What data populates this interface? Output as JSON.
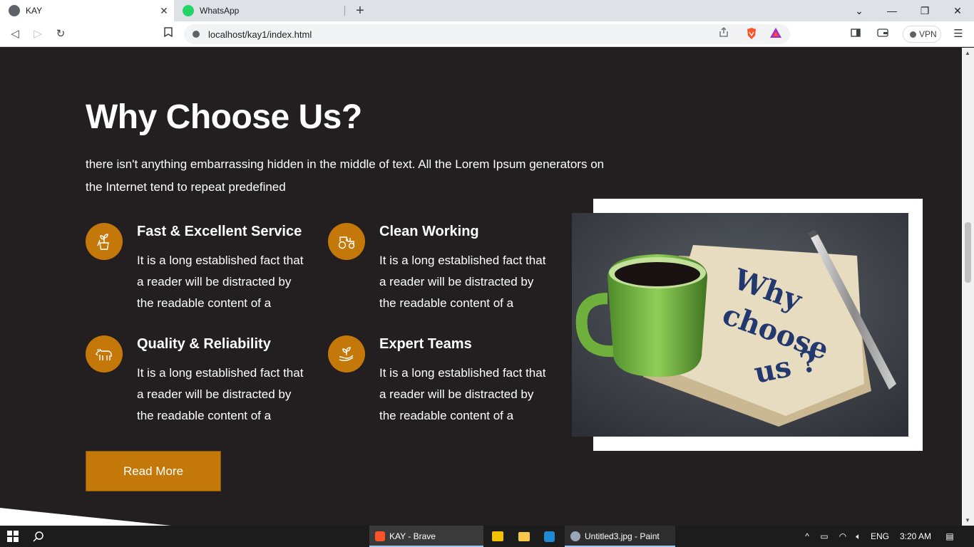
{
  "browser": {
    "tabs": [
      {
        "title": "KAY",
        "active": true
      },
      {
        "title": "WhatsApp",
        "active": false
      }
    ],
    "new_tab_icon": "+",
    "url": "localhost/kay1/index.html",
    "vpn_label": "VPN",
    "window_controls": {
      "minimize": "—",
      "restore": "❐",
      "close": "✕"
    }
  },
  "section": {
    "heading": "Why Choose Us?",
    "intro": "there isn't anything embarrassing hidden in the middle of text. All the Lorem Ipsum generators on the Internet tend to repeat predefined",
    "features": [
      {
        "title": "Fast & Excellent Service",
        "desc": "It is a long established fact that a reader will be distracted by the readable content of a",
        "icon": "plant-pot-icon"
      },
      {
        "title": "Clean Working",
        "desc": "It is a long established fact that a reader will be distracted by the readable content of a",
        "icon": "tractor-icon"
      },
      {
        "title": "Quality & Reliability",
        "desc": "It is a long established fact that a reader will be distracted by the readable content of a",
        "icon": "cow-icon"
      },
      {
        "title": "Expert Teams",
        "desc": "It is a long established fact that a reader will be distracted by the readable content of a",
        "icon": "sprout-hand-icon"
      }
    ],
    "read_more_label": "Read More",
    "image_text": [
      "Why",
      "choose",
      "us ?"
    ]
  },
  "taskbar": {
    "apps": [
      {
        "label": "KAY - Brave"
      },
      {
        "label": "Untitled3.jpg - Paint"
      }
    ],
    "language": "ENG",
    "time": "3:20 AM"
  },
  "colors": {
    "accent": "#c47809",
    "background": "#231f20",
    "text": "#ffffff"
  }
}
